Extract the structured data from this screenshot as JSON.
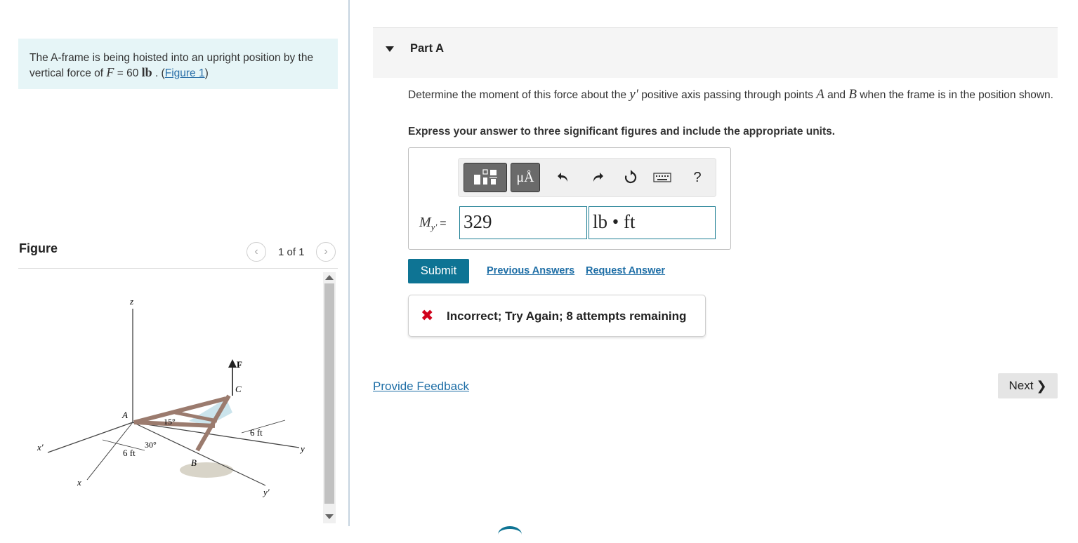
{
  "problem": {
    "text_before": "The A-frame is being hoisted into an upright position by the vertical force of ",
    "force_var": "F",
    "force_eq": " = 60 ",
    "force_unit": "lb",
    "separator": " . (",
    "figure_link": "Figure 1",
    "close_paren": ")"
  },
  "figure": {
    "title": "Figure",
    "pager": "1 of 1",
    "labels": {
      "z": "z",
      "F": "F",
      "C": "C",
      "A": "A",
      "B": "B",
      "x_prime": "x′",
      "x": "x",
      "y": "y",
      "y_prime": "y′",
      "angle_15": "15°",
      "angle_30": "30°",
      "dim_left": "6 ft",
      "dim_right": "6 ft"
    }
  },
  "part": {
    "title": "Part A",
    "question_1": "Determine the moment of this force about the ",
    "question_var": "y′",
    "question_2": " positive axis passing through points ",
    "point_a": "A",
    "question_and": " and ",
    "point_b": "B",
    "question_3": " when the frame is in the position shown.",
    "instruction": "Express your answer to three significant figures and include the appropriate units."
  },
  "answer": {
    "symbol": "M",
    "subscript": "y′",
    "equals": "=",
    "value": "329",
    "units": "lb • ft"
  },
  "toolbar": {
    "units_label": "μÅ",
    "help_label": "?"
  },
  "actions": {
    "submit": "Submit",
    "previous_answers": "Previous Answers",
    "request_answer": "Request Answer"
  },
  "feedback": {
    "status": "Incorrect; Try Again; 8 attempts remaining"
  },
  "footer": {
    "provide_feedback": "Provide Feedback",
    "next": "Next"
  },
  "colors": {
    "accent": "#0e7494",
    "problem_bg": "#e6f5f7",
    "error": "#d0021b",
    "link": "#1e6ea6"
  }
}
